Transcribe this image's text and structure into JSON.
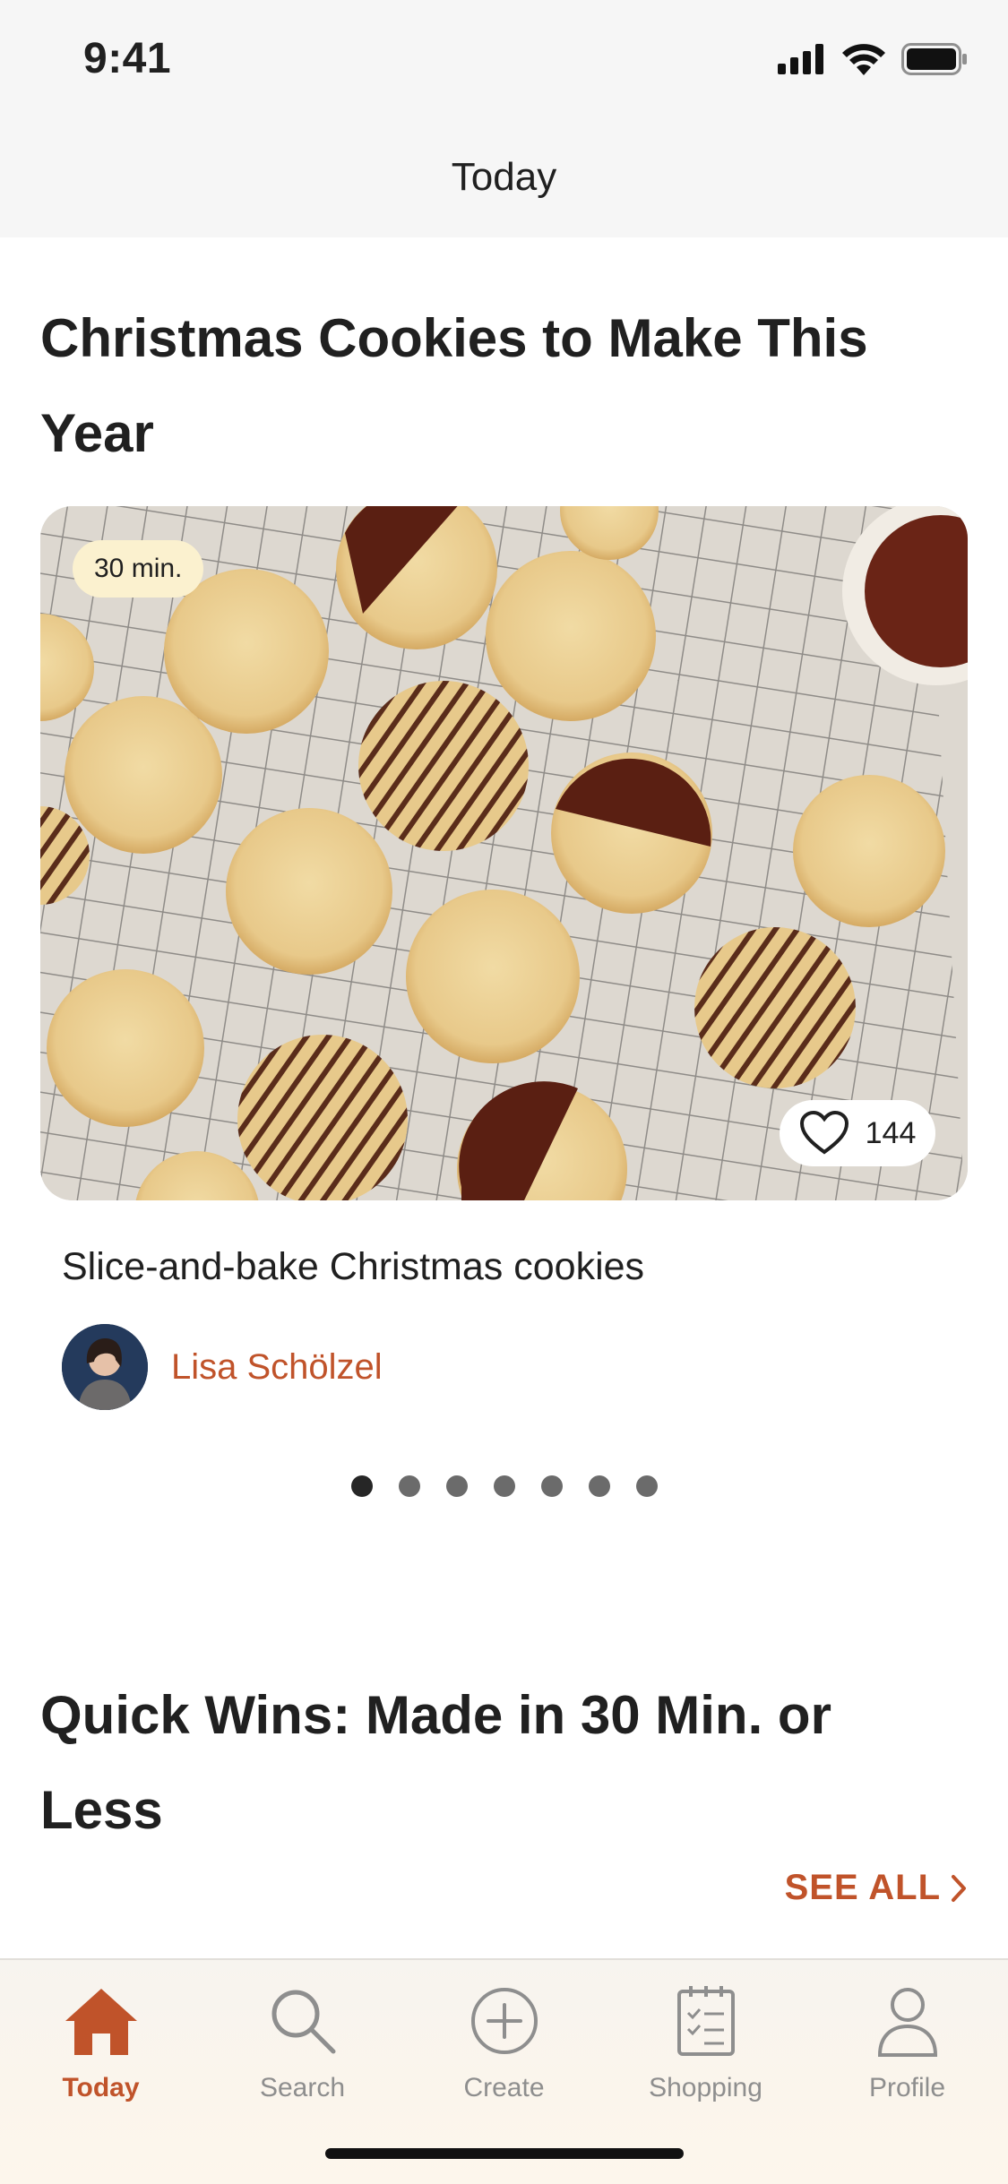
{
  "status_bar": {
    "time": "9:41"
  },
  "nav": {
    "title": "Today"
  },
  "section1": {
    "title": "Christmas Cookies to Make This Year",
    "card": {
      "time_badge": "30 min.",
      "likes": "144",
      "recipe_title": "Slice-and-bake Christmas cookies",
      "author": "Lisa Schölzel"
    },
    "carousel": {
      "total": 7,
      "active_index": 0
    }
  },
  "section2": {
    "title": "Quick Wins: Made in 30 Min. or Less",
    "see_all": "SEE ALL"
  },
  "tabs": [
    {
      "label": "Today",
      "icon": "home-icon",
      "active": true
    },
    {
      "label": "Search",
      "icon": "search-icon",
      "active": false
    },
    {
      "label": "Create",
      "icon": "plus-circle-icon",
      "active": false
    },
    {
      "label": "Shopping",
      "icon": "shopping-list-icon",
      "active": false
    },
    {
      "label": "Profile",
      "icon": "person-icon",
      "active": false
    }
  ],
  "colors": {
    "accent": "#c0532a",
    "badge_bg": "#fbf1cf",
    "inactive": "#8e8e8e"
  }
}
